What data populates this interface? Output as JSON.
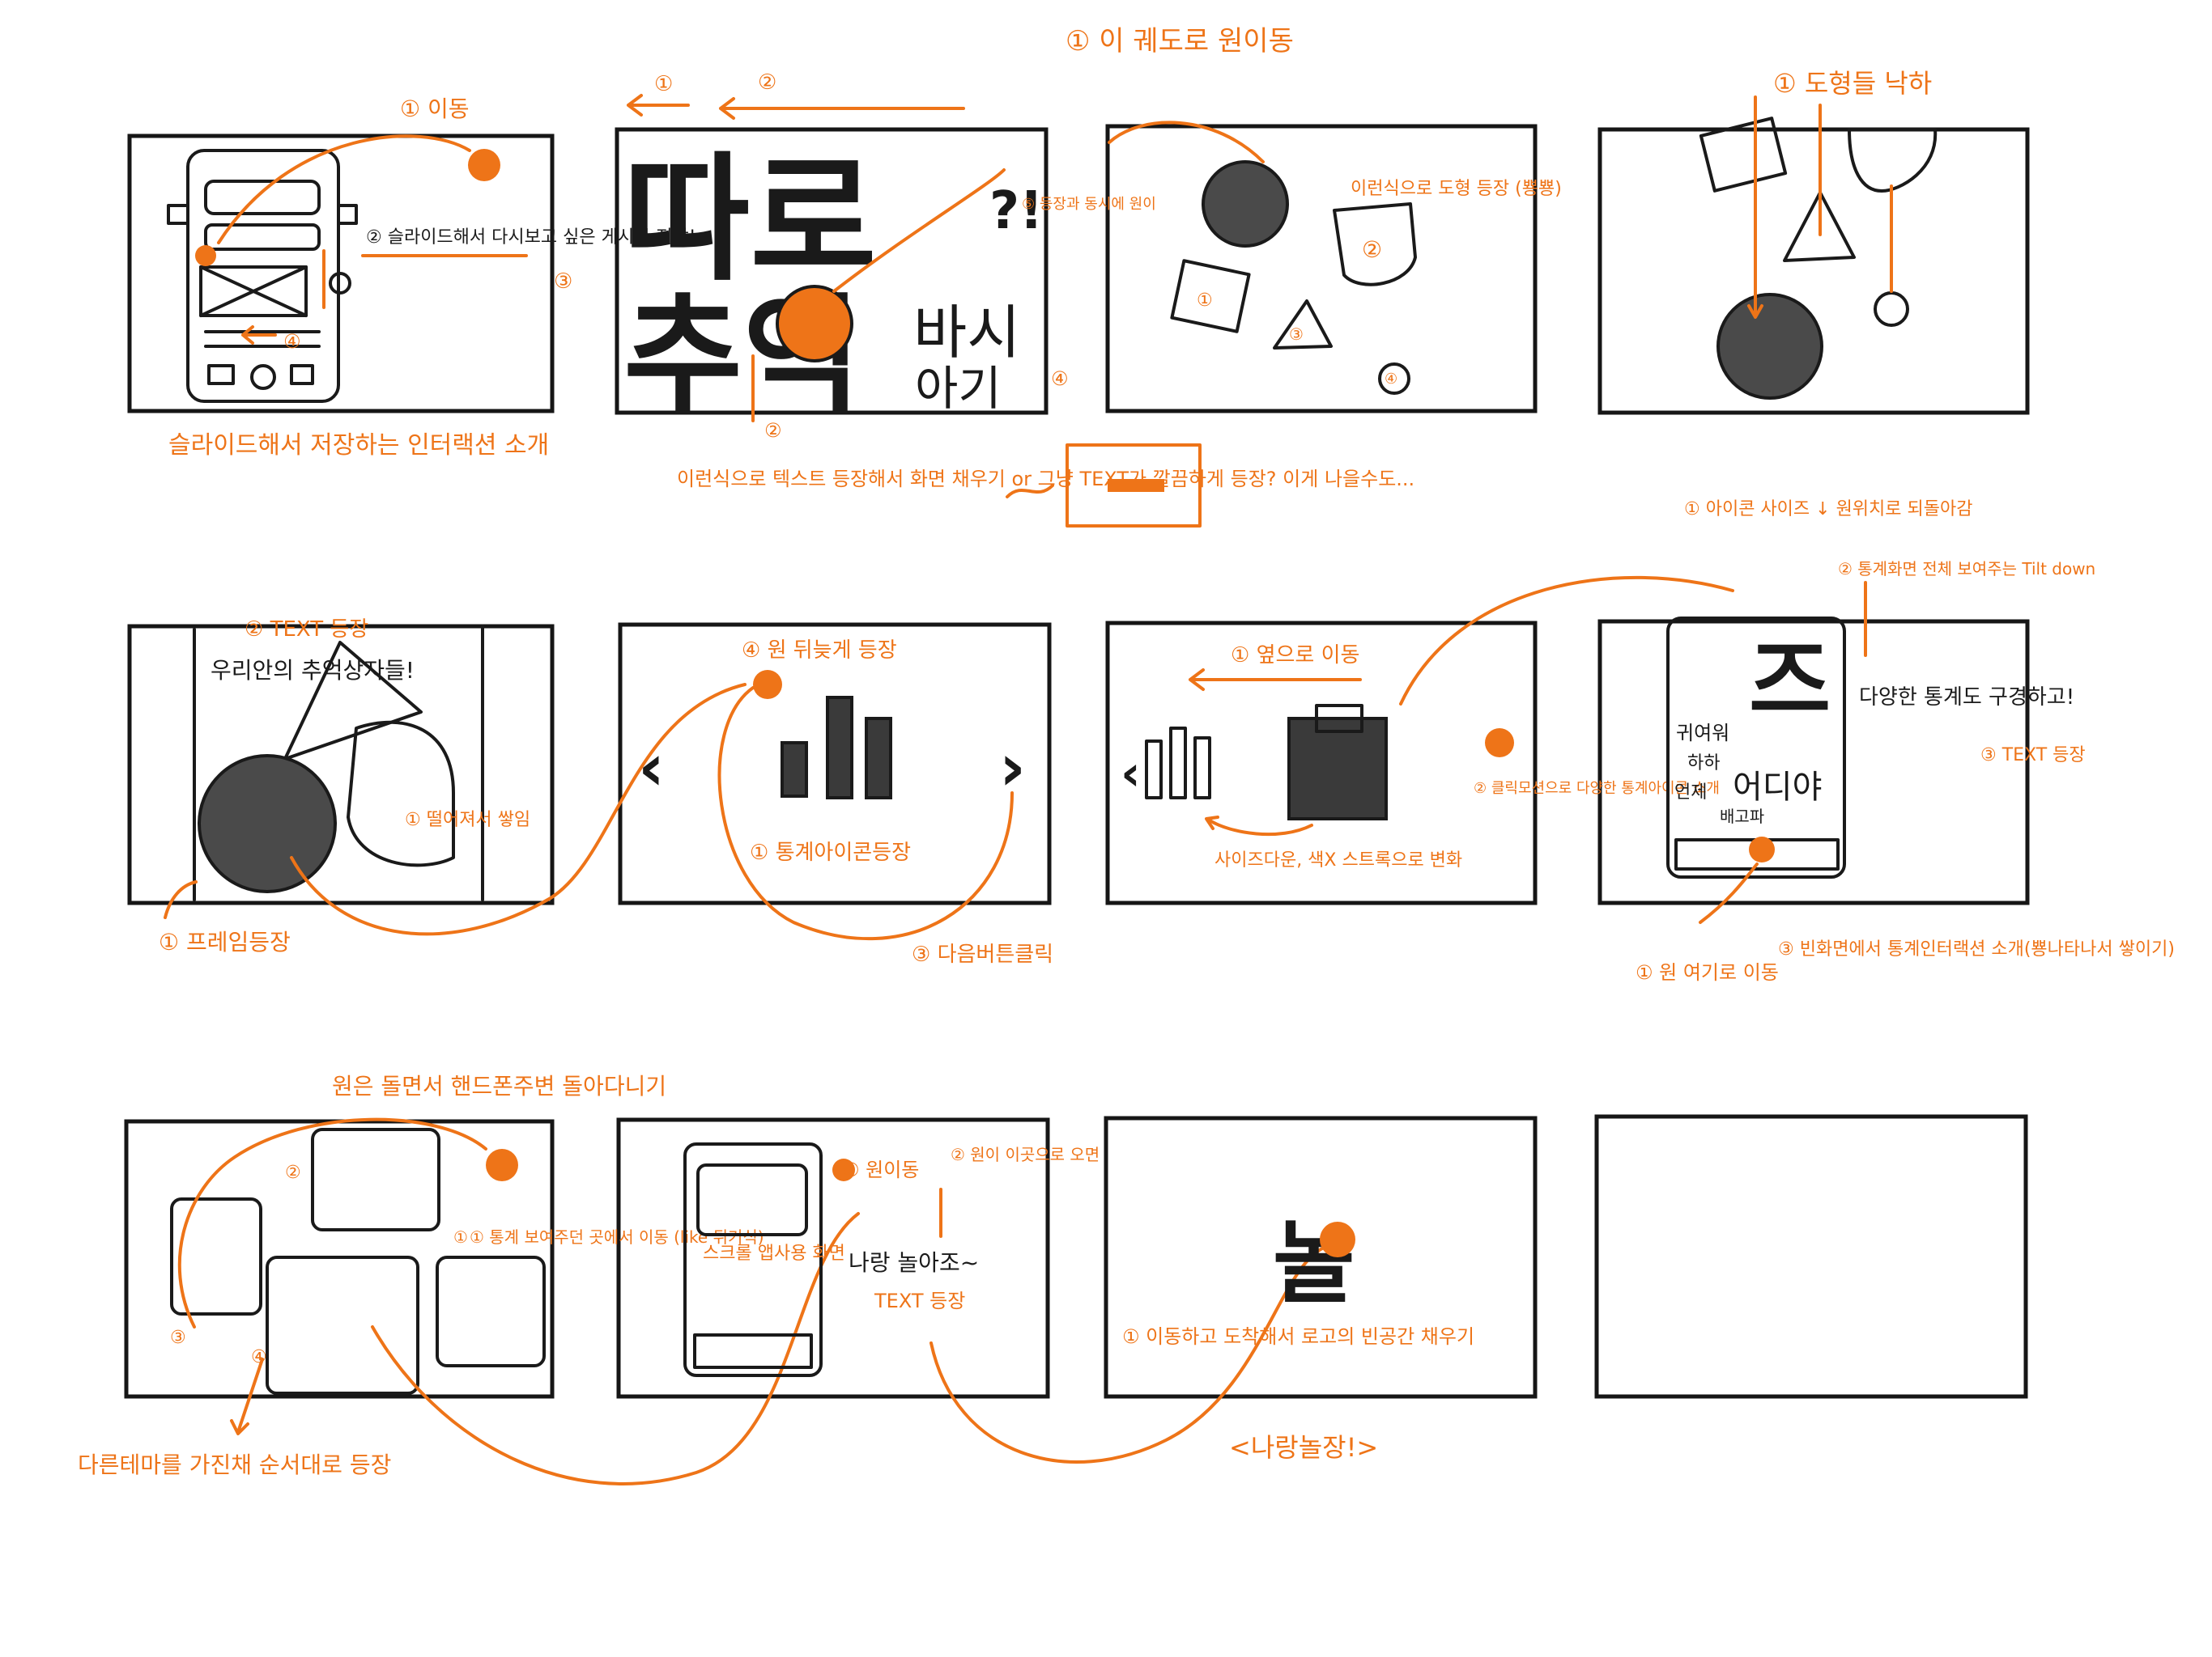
{
  "colors": {
    "accent": "#ee7418",
    "ink": "#1a1a1a",
    "fill_dark": "#444444"
  },
  "panel1": {
    "move_note": "① 이동",
    "slide_note": "② 슬라이드해서 다시보고 싶은 게시물 저장!",
    "num3": "③",
    "num4": "④",
    "caption": "슬라이드해서 저장하는 인터랙션 소개"
  },
  "panel2": {
    "arrow1": "①",
    "arrow2": "②",
    "big_text_1": "따로",
    "big_text_2": "추억",
    "side_text_1": "바시",
    "side_text_2": "아기",
    "question": "?!",
    "appear_note": "⑤ 등장과 동시에 원이",
    "num2": "②",
    "num4": "④",
    "caption": "이런식으로 텍스트 등장해서 화면 채우기 or 그냥 TEXT가 깔끔하게 등장? 이게 나을수도...",
    "box_note": "↗↗"
  },
  "panel3": {
    "top_note": "① 이 궤도로 원이동",
    "side_note": "이런식으로 도형 등장 (뿅뿅)",
    "n1": "①",
    "n2": "②",
    "n3": "③",
    "n4": "④"
  },
  "panel4": {
    "top_note": "① 도형들 낙하"
  },
  "panel5": {
    "text_note": "② TEXT 등장",
    "sticker_text": "우리안의 추억상자들!",
    "fall_note": "① 떨어져서 쌓임",
    "frame_note": "① 프레임등장"
  },
  "panel6": {
    "circle_note": "④ 원 뒤늦게 등장",
    "icon_note": "① 통계아이콘등장",
    "next_note": "③ 다음버튼클릭",
    "prev_arrow": "‹",
    "next_arrow": "›"
  },
  "panel7": {
    "move_note": "① 옆으로 이동",
    "size_note": "사이즈다운, 색X 스트록으로 변화",
    "click_note": "② 클릭모션으로 다양한 통계아이콘 소개"
  },
  "panel8": {
    "icon_size_note": "① 아이콘 사이즈 ↓ 원위치로 되돌아감",
    "full_note": "② 통계화면 전체 보여주는 Tilt down",
    "phone_text_1": "귀여워",
    "phone_text_2": "하하",
    "phone_text_3": "언제",
    "phone_text_4": "어디야",
    "phone_text_5": "배고파",
    "big_letter": "즈",
    "side_text": "다양한 통계도 구경하고!",
    "text_appear": "③ TEXT 등장",
    "circle_note": "① 원 여기로 이동",
    "interaction_note": "③ 빈화면에서 통계인터랙션 소개(뿅나타나서 쌓이기)"
  },
  "panel9": {
    "top_note": "원은 돌면서 핸드폰주변 돌아다니기",
    "show_note": "① 통계 보여주던 곳에서 이동 (like 튀기식)",
    "n1": "①",
    "n2": "②",
    "n3": "③",
    "n4": "④",
    "bottom_note": "다른테마를 가진채 순서대로 등장"
  },
  "panel10": {
    "move_note": "① 원이동",
    "enter_note": "② 원이 이곳으로 오면",
    "screen_note": "스크롤 앱사용 화면",
    "text_1": "나랑 놀아조~",
    "text_2": "TEXT 등장"
  },
  "panel11": {
    "logo": "놀",
    "fill_note": "① 이동하고 도착해서 로고의 빈공간 채우기",
    "slogan": "<나랑놀장!>"
  }
}
